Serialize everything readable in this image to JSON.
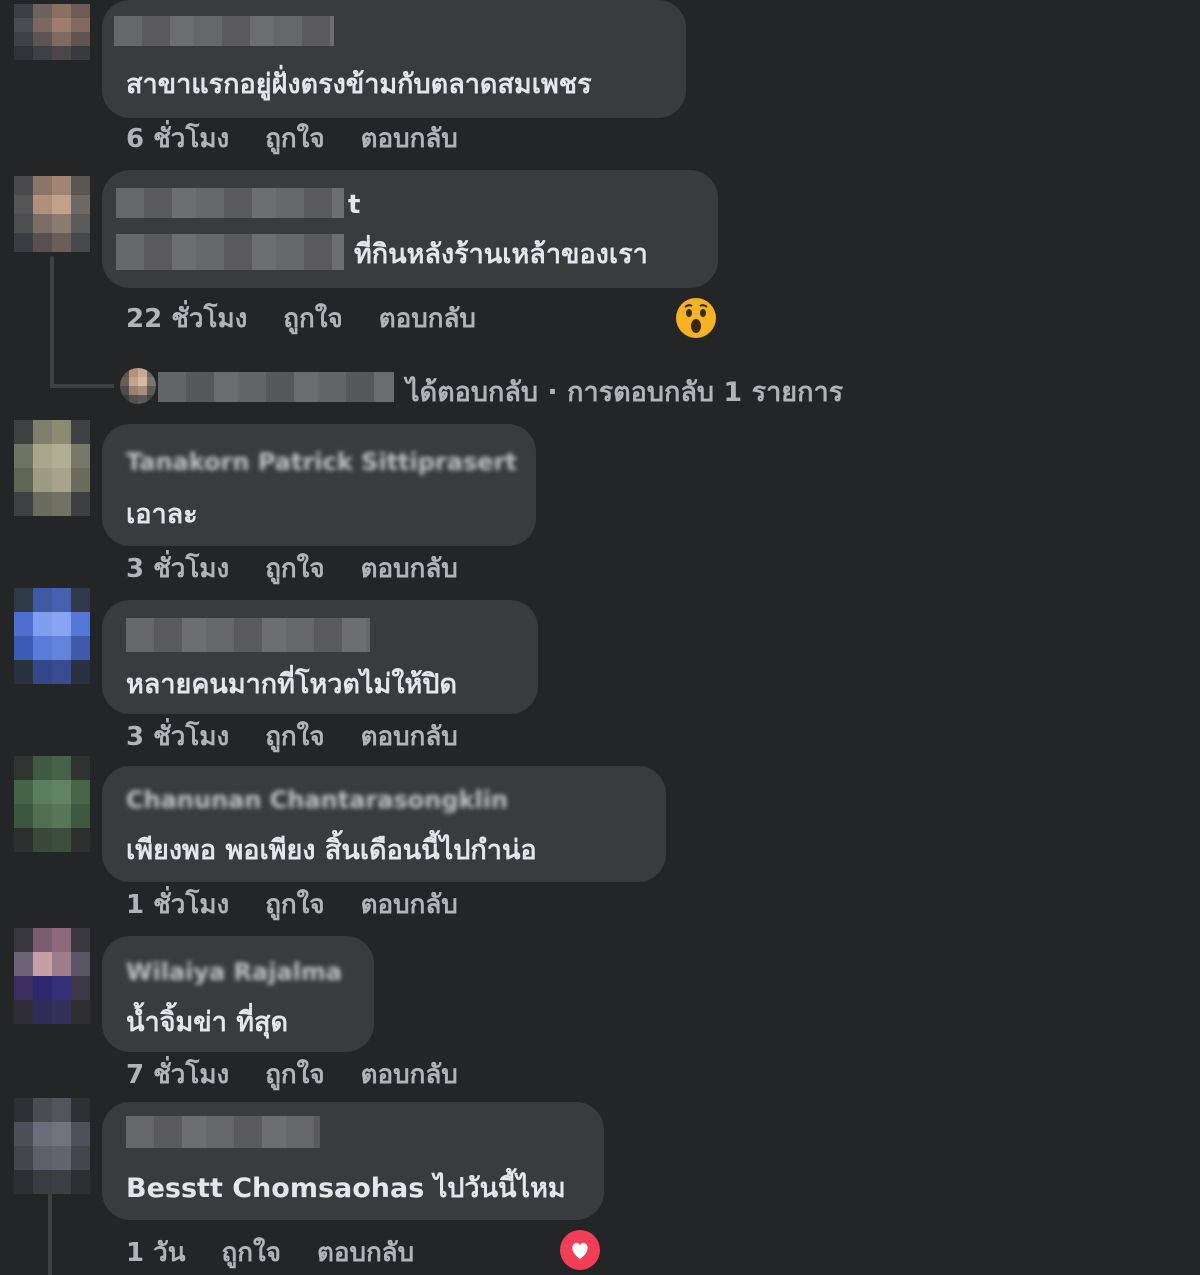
{
  "comments": [
    {
      "text": "สาขาแรกอยู่ฝั่งตรงข้ามกับตลาดสมเพชร",
      "time": "6 ชั่วโมง",
      "like": "ถูกใจ",
      "reply": "ตอบกลับ"
    },
    {
      "name_fragment": "t",
      "text": "ที่กินหลังร้านเหล้าของเรา",
      "time": "22 ชั่วโมง",
      "like": "ถูกใจ",
      "reply": "ตอบกลับ",
      "reaction": "wow-emoji",
      "replies_summary": "ได้ตอบกลับ · การตอบกลับ 1 รายการ"
    },
    {
      "name": "Tanakorn Patrick Sittiprasert",
      "text": "เอาละ",
      "time": "3 ชั่วโมง",
      "like": "ถูกใจ",
      "reply": "ตอบกลับ"
    },
    {
      "text": "หลายคนมากที่โหวตไม่ให้ปิด",
      "time": "3 ชั่วโมง",
      "like": "ถูกใจ",
      "reply": "ตอบกลับ"
    },
    {
      "name": "Chanunan Chantarasongklin",
      "text": "เพียงพอ พอเพียง สิ้นเดือนนี้ไปกำน่อ",
      "time": "1 ชั่วโมง",
      "like": "ถูกใจ",
      "reply": "ตอบกลับ"
    },
    {
      "name": "Wilaiya Rajalma",
      "text": "น้ำจิ้มข่า ที่สุด",
      "time": "7 ชั่วโมง",
      "like": "ถูกใจ",
      "reply": "ตอบกลับ"
    },
    {
      "text": "Besstt Chomsaohas ไปวันนี้ไหม",
      "time": "1 วัน",
      "like": "ถูกใจ",
      "reply": "ตอบกลับ",
      "reaction": "heart-emoji"
    }
  ],
  "colors": {
    "background": "#242526",
    "bubble": "#3a3b3c",
    "text": "#e4e6eb",
    "meta": "#b0b3b8",
    "heart": "#f33e58",
    "wow": "#f7b125"
  }
}
